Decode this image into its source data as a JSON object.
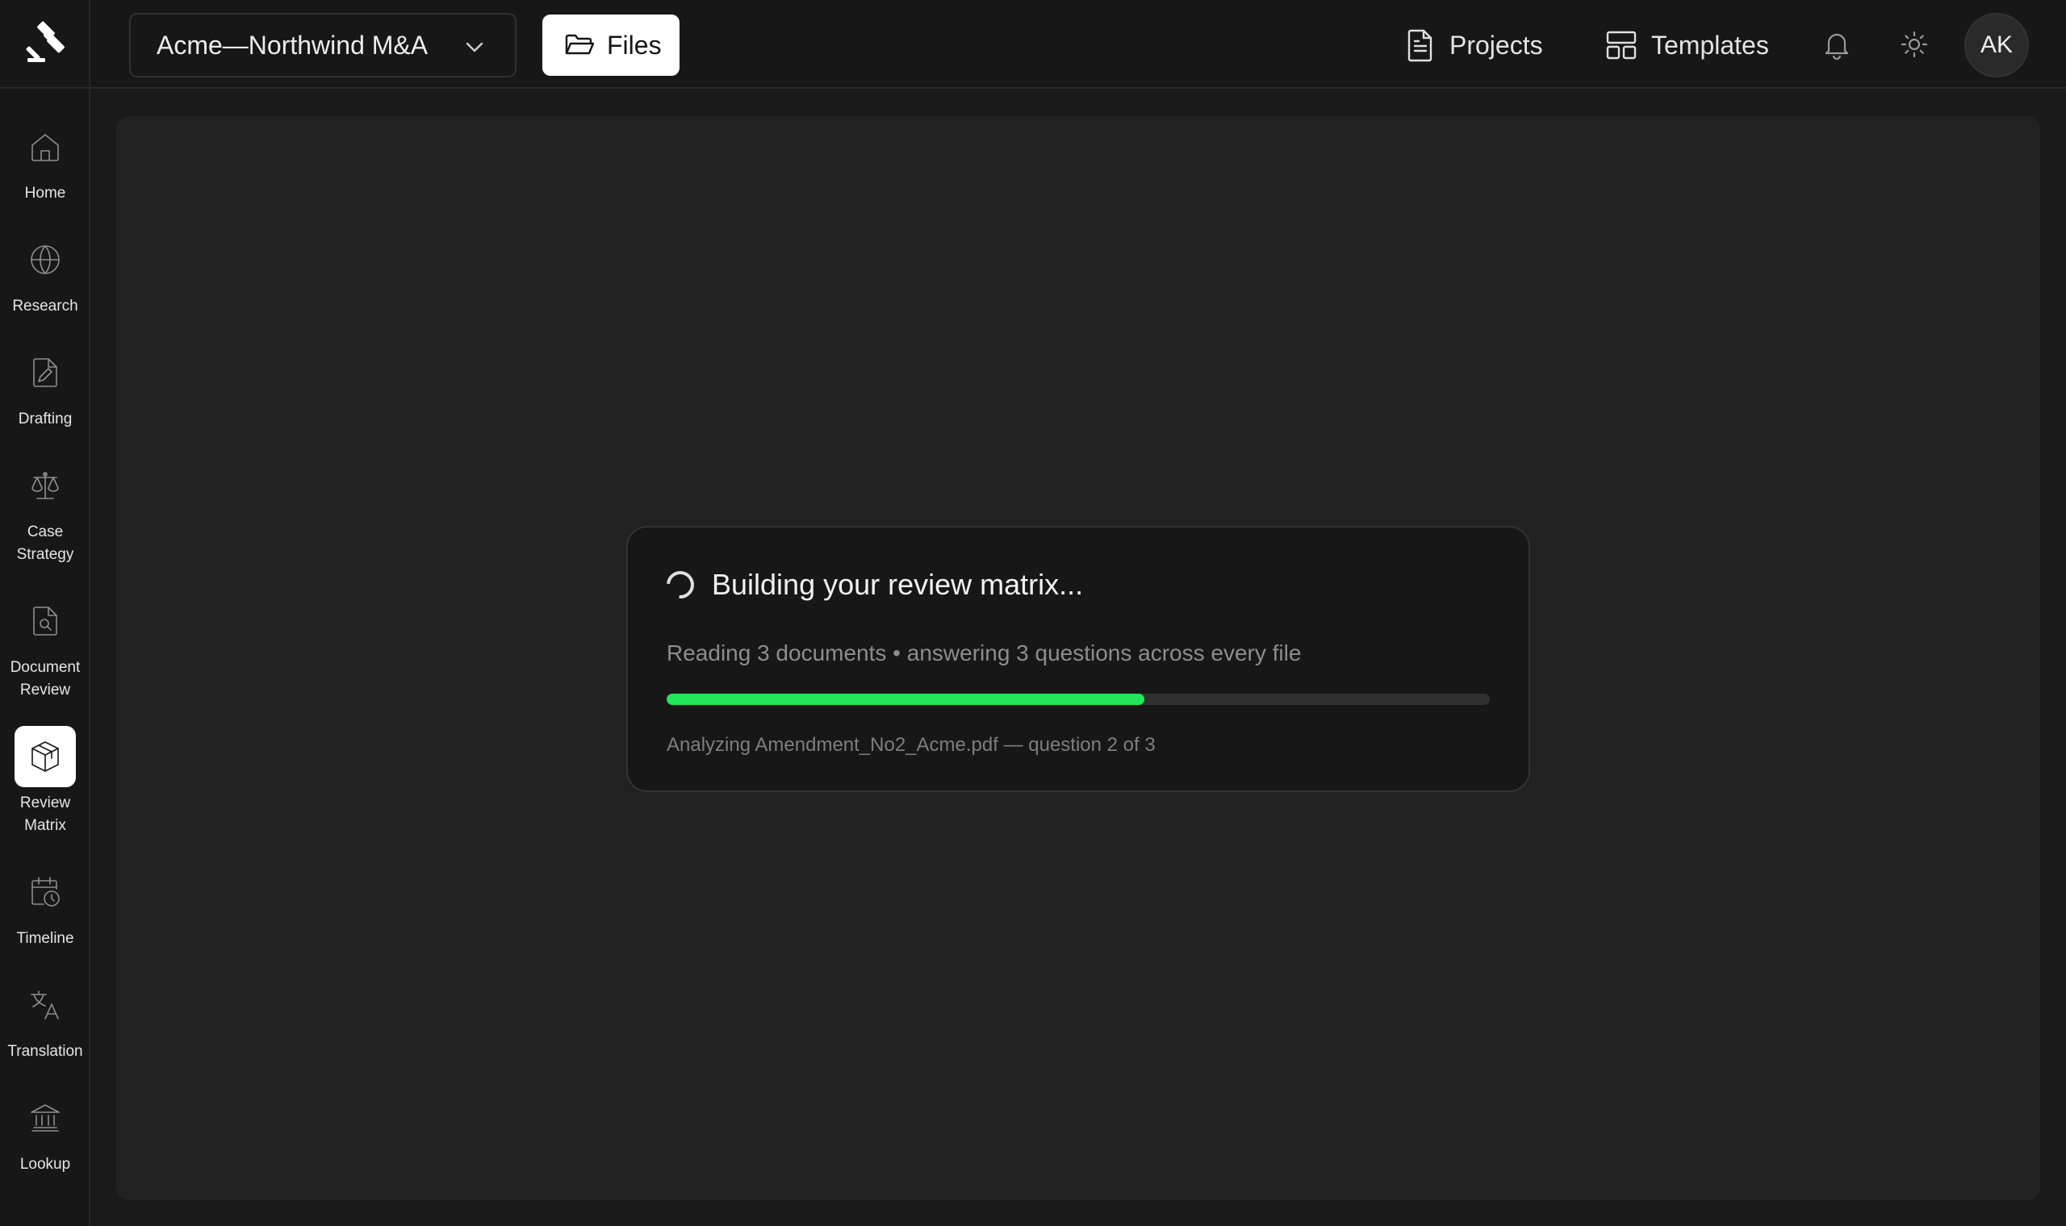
{
  "sidebar": {
    "items": [
      {
        "label_lines": [
          "Home"
        ],
        "icon": "home-icon",
        "active": false
      },
      {
        "label_lines": [
          "Research"
        ],
        "icon": "globe-icon",
        "active": false
      },
      {
        "label_lines": [
          "Drafting"
        ],
        "icon": "edit-document-icon",
        "active": false
      },
      {
        "label_lines": [
          "Case",
          "Strategy"
        ],
        "icon": "scales-icon",
        "active": false
      },
      {
        "label_lines": [
          "Document",
          "Review"
        ],
        "icon": "document-search-icon",
        "active": false
      },
      {
        "label_lines": [
          "Review",
          "Matrix"
        ],
        "icon": "cube-icon",
        "active": true
      },
      {
        "label_lines": [
          "Timeline"
        ],
        "icon": "calendar-clock-icon",
        "active": false
      },
      {
        "label_lines": [
          "Translation"
        ],
        "icon": "translate-icon",
        "active": false
      },
      {
        "label_lines": [
          "Lookup"
        ],
        "icon": "bank-icon",
        "active": false
      }
    ]
  },
  "header": {
    "project_name": "Acme—Northwind M&A",
    "files_label": "Files",
    "projects_label": "Projects",
    "templates_label": "Templates",
    "avatar_initials": "AK"
  },
  "progress_card": {
    "title": "Building your review matrix...",
    "subtitle": "Reading 3 documents • answering 3 questions across every file",
    "progress_fraction": 0.58,
    "status": "Analyzing Amendment_No2_Acme.pdf — question 2 of 3"
  },
  "colors": {
    "accent_green": "#22e55a",
    "background": "#1a1a1a",
    "panel": "#212121"
  }
}
